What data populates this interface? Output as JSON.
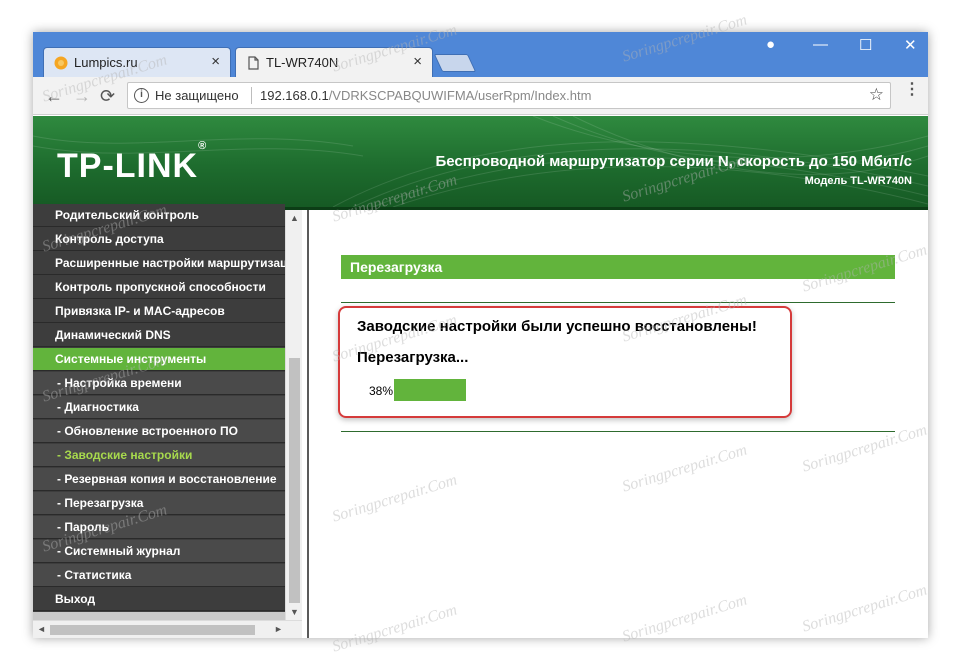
{
  "browser": {
    "tabs": [
      {
        "title": "Lumpics.ru",
        "close": "×"
      },
      {
        "title": "TL-WR740N",
        "close": "×"
      }
    ],
    "controls": {
      "minimize": "—",
      "maximize": "☐",
      "close": "✕",
      "profile": "●"
    },
    "address": {
      "insecure_label": "Не защищено",
      "url_host": "192.168.0.1",
      "url_path": "/VDRKSCPABQUWIFMA/userRpm/Index.htm"
    },
    "nav": {
      "back": "←",
      "forward": "→",
      "reload": "⟳",
      "star": "☆",
      "menu": "⋮"
    }
  },
  "router": {
    "logo": "TP-LINK",
    "logo_mark": "®",
    "title": "Беспроводной маршрутизатор серии N, скорость до 150 Мбит/с",
    "model": "Модель TL-WR740N"
  },
  "sidebar": {
    "items": [
      {
        "label": "Родительский контроль"
      },
      {
        "label": "Контроль доступа"
      },
      {
        "label": "Расширенные настройки маршрутизации"
      },
      {
        "label": "Контроль пропускной способности"
      },
      {
        "label": "Привязка IP- и MAC-адресов"
      },
      {
        "label": "Динамический DNS"
      },
      {
        "label": "Системные инструменты"
      },
      {
        "label": "- Настройка времени"
      },
      {
        "label": "- Диагностика"
      },
      {
        "label": "- Обновление встроенного ПО"
      },
      {
        "label": "- Заводские настройки"
      },
      {
        "label": "- Резервная копия и восстановление"
      },
      {
        "label": "- Перезагрузка"
      },
      {
        "label": "- Пароль"
      },
      {
        "label": "- Системный журнал"
      },
      {
        "label": "- Статистика"
      },
      {
        "label": "Выход"
      }
    ],
    "scroll": {
      "up": "▲",
      "down": "▼",
      "left": "◄",
      "right": "►"
    }
  },
  "main": {
    "section_title": "Перезагрузка",
    "message": "Заводские настройки были успешно восстановлены!",
    "status": "Перезагрузка...",
    "progress_label": "38%",
    "progress_value": 0.38
  },
  "watermark": "Soringpcrepair.Com",
  "colors": {
    "accent_green": "#62b43c",
    "highlight_red": "#d53b3b",
    "sidebar_bg": "#3d3d3d",
    "tab_blue": "#4f87d7"
  }
}
